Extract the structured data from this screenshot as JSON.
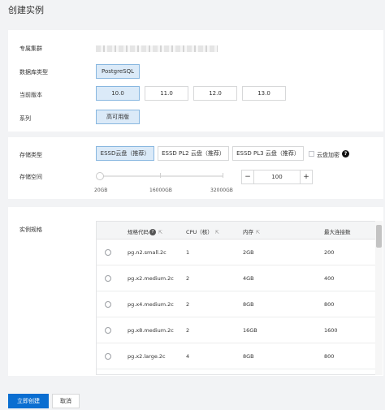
{
  "page_title": "创建实例",
  "basic": {
    "cluster_label": "专属集群",
    "db_type_label": "数据库类型",
    "db_type": "PostgreSQL",
    "version_label": "当前版本",
    "versions": [
      "10.0",
      "11.0",
      "12.0",
      "13.0"
    ],
    "selected_version": "10.0",
    "series_label": "系列",
    "series": "高可用版"
  },
  "storage": {
    "type_label": "存储类型",
    "types": [
      "ESSD云盘（推荐）",
      "ESSD PL2 云盘（推荐）",
      "ESSD PL3 云盘（推荐）"
    ],
    "selected_type": "ESSD云盘（推荐）",
    "encrypt_label": "云盘加密",
    "space_label": "存储空间",
    "slider_ticks": [
      "20GB",
      "16000GB",
      "32000GB"
    ],
    "slider_value_fraction": 0.0,
    "minus": "−",
    "plus": "+",
    "value": "100"
  },
  "spec": {
    "label": "实例规格",
    "columns": [
      "规格代码",
      "CPU（核）",
      "内存",
      "最大连接数"
    ],
    "filter_icon": "filter-icon",
    "help_glyph": "?",
    "rows": [
      {
        "code": "pg.n2.small.2c",
        "cpu": "1",
        "mem": "2GB",
        "conn": "200"
      },
      {
        "code": "pg.x2.medium.2c",
        "cpu": "2",
        "mem": "4GB",
        "conn": "400"
      },
      {
        "code": "pg.x4.medium.2c",
        "cpu": "2",
        "mem": "8GB",
        "conn": "800"
      },
      {
        "code": "pg.x8.medium.2c",
        "cpu": "2",
        "mem": "16GB",
        "conn": "1600"
      },
      {
        "code": "pg.x2.large.2c",
        "cpu": "4",
        "mem": "8GB",
        "conn": "800"
      }
    ]
  },
  "footer": {
    "create": "立即创建",
    "cancel": "取消"
  }
}
